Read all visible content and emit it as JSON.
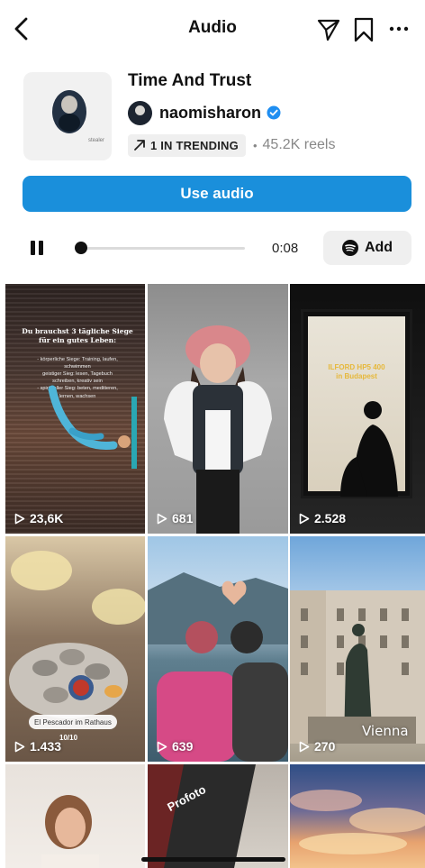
{
  "header": {
    "title": "Audio",
    "icons": [
      "back-chevron-icon",
      "send-icon",
      "bookmark-icon",
      "more-icon"
    ]
  },
  "track": {
    "title": "Time And Trust",
    "artist": "naomisharon",
    "verified": true,
    "cover_tag": "stealer",
    "trending_label": "1 IN TRENDING",
    "reels_count": "45.2K reels"
  },
  "actions": {
    "use_audio_label": "Use audio",
    "accent_color": "#1a8fdb"
  },
  "player": {
    "state": "playing",
    "time": "0:08",
    "progress": 0.04,
    "add_label": "Add"
  },
  "reels": [
    {
      "views": "23,6K",
      "headline": "Du brauchst 3 tägliche Siege für ein gutes Leben:",
      "body": "- körperliche Siege: Training, laufen, schwimmen\ngeistiger Sieg: lesen, Tagebuch schreiben, kreativ sein\n- spiritueller Sieg: beten, meditieren, lernen, wachsen"
    },
    {
      "views": "681"
    },
    {
      "views": "2.528",
      "overlay_text": "ILFORD HP5 400\nin Budapest"
    },
    {
      "views": "1.433",
      "place_tag": "El Pescador im Rathaus",
      "counter": "10/10"
    },
    {
      "views": "639"
    },
    {
      "views": "270",
      "place_text": "Vienna"
    },
    {
      "views": ""
    },
    {
      "views": "",
      "brand": "Profoto"
    },
    {
      "views": ""
    }
  ]
}
